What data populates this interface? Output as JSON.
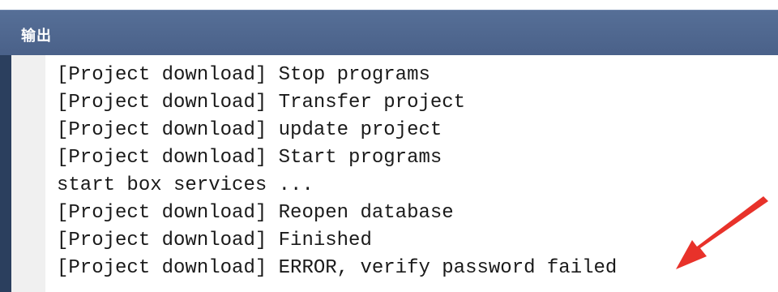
{
  "panel": {
    "title": "输出"
  },
  "output": {
    "lines": [
      "[Project download] Stop programs",
      "[Project download] Transfer project",
      "[Project download] update project",
      "[Project download] Start programs",
      "start box services ...",
      "[Project download] Reopen database",
      "[Project download] Finished",
      "[Project download] ERROR, verify password failed"
    ]
  },
  "annotation": {
    "arrow_color": "#e8322a"
  }
}
